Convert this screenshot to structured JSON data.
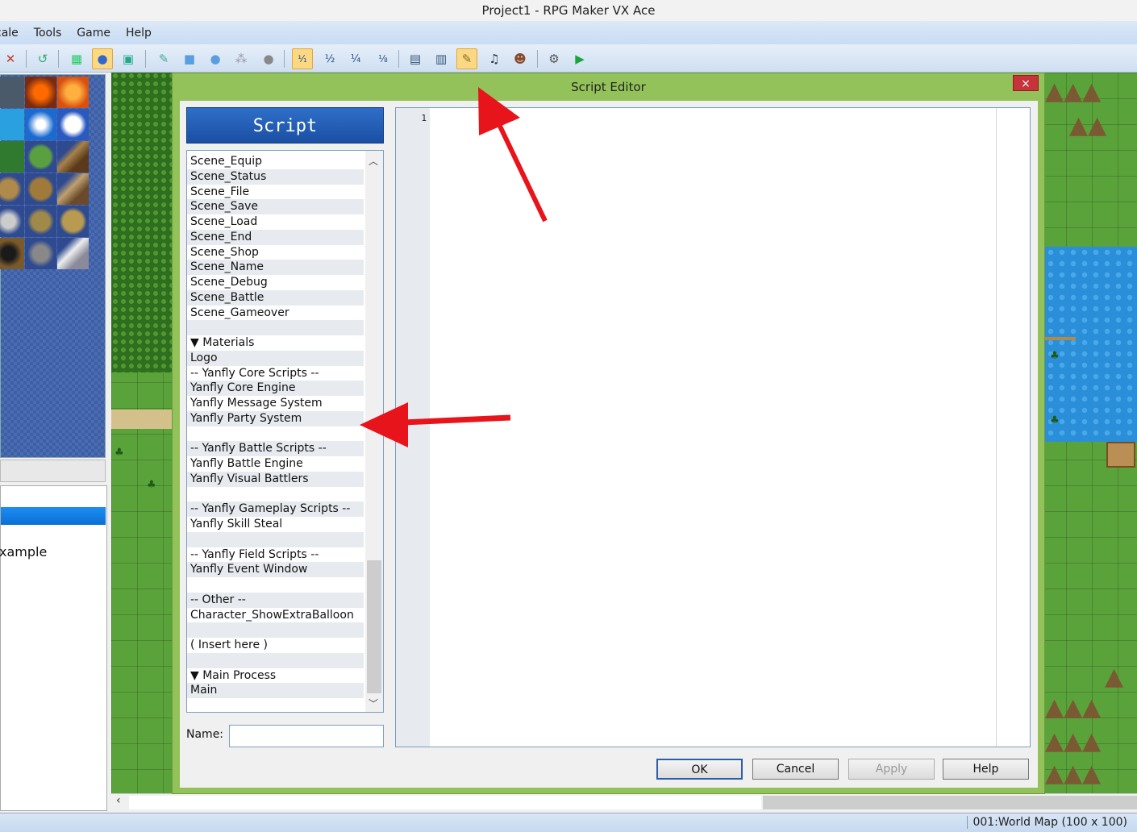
{
  "window": {
    "title": "Project1 - RPG Maker VX Ace"
  },
  "menu": [
    "cale",
    "Tools",
    "Game",
    "Help"
  ],
  "statusbar": {
    "map": "001:World Map (100 x 100)"
  },
  "maptree": {
    "selected": "",
    "item": "xample"
  },
  "script_editor": {
    "title": "Script Editor",
    "close": "×",
    "header": "Script",
    "items": [
      "Scene_Equip",
      "Scene_Status",
      "Scene_File",
      "Scene_Save",
      "Scene_Load",
      "Scene_End",
      "Scene_Shop",
      "Scene_Name",
      "Scene_Debug",
      "Scene_Battle",
      "Scene_Gameover",
      "",
      "▼ Materials",
      "Logo",
      "-- Yanfly Core Scripts --",
      "Yanfly Core Engine",
      "Yanfly Message System",
      "Yanfly Party System",
      "",
      "-- Yanfly Battle Scripts --",
      "Yanfly Battle Engine",
      "Yanfly Visual Battlers",
      "",
      "-- Yanfly Gameplay Scripts --",
      "Yanfly Skill Steal",
      "",
      "-- Yanfly Field Scripts --",
      "Yanfly Event Window",
      "",
      "-- Other --",
      "Character_ShowExtraBalloon",
      "",
      "( Insert here )",
      "",
      "▼ Main Process",
      "Main"
    ],
    "name_label": "Name:",
    "name_value": "",
    "line_number": "1",
    "buttons": {
      "ok": "OK",
      "cancel": "Cancel",
      "apply": "Apply",
      "help": "Help"
    }
  },
  "icons": {
    "close": "close-icon",
    "gear": "gear-icon",
    "play": "play-icon"
  },
  "colors": {
    "dialog_frame": "#93c25a",
    "header_blue": "#1a4fa3",
    "arrow": "#e8141b"
  }
}
